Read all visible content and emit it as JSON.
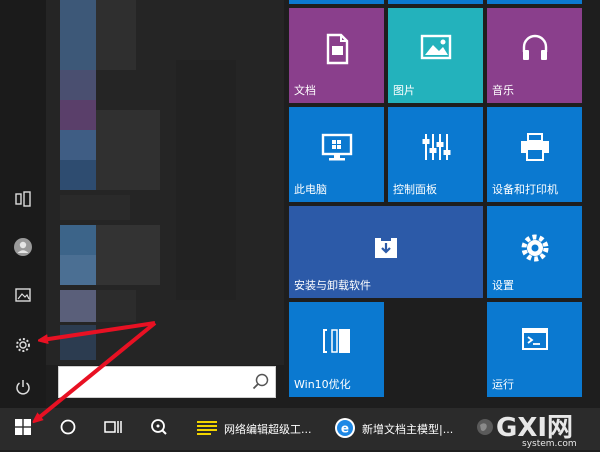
{
  "tiles": [
    {
      "label": "文档",
      "color": "#8a3f8c",
      "icon": "document-icon"
    },
    {
      "label": "图片",
      "color": "#23b2bc",
      "icon": "picture-icon"
    },
    {
      "label": "音乐",
      "color": "#8a3f8c",
      "icon": "headphones-icon"
    },
    {
      "label": "此电脑",
      "color": "#0b79d0",
      "icon": "computer-icon"
    },
    {
      "label": "控制面板",
      "color": "#0b79d0",
      "icon": "control-panel-icon"
    },
    {
      "label": "设备和打印机",
      "color": "#0b79d0",
      "icon": "printer-icon"
    },
    {
      "label": "安装与卸载软件",
      "color": "#2c5aa8",
      "icon": "install-box-icon"
    },
    {
      "label": "设置",
      "color": "#0b79d0",
      "icon": "gear-icon"
    },
    {
      "label": "Win10优化",
      "color": "#0b79d0",
      "icon": "optimize-icon"
    },
    {
      "label": "运行",
      "color": "#0b79d0",
      "icon": "run-icon"
    }
  ],
  "left_rail": [
    "tablet-mode-icon",
    "user-icon",
    "pictures-folder-icon",
    "settings-gear-icon",
    "power-icon"
  ],
  "search": {
    "placeholder": ""
  },
  "taskbar": {
    "apps": [
      {
        "label": "网络编辑超级工...",
        "icon": "notepad-icon"
      },
      {
        "label": "新增文档主模型|...",
        "icon": "browser-e-icon"
      }
    ]
  },
  "watermark": {
    "text": "GXI网",
    "sub": "system.com"
  },
  "colors": {
    "accent": "#0b79d0",
    "arrow": "#e81123",
    "taskbar": "#2b2b2b"
  }
}
